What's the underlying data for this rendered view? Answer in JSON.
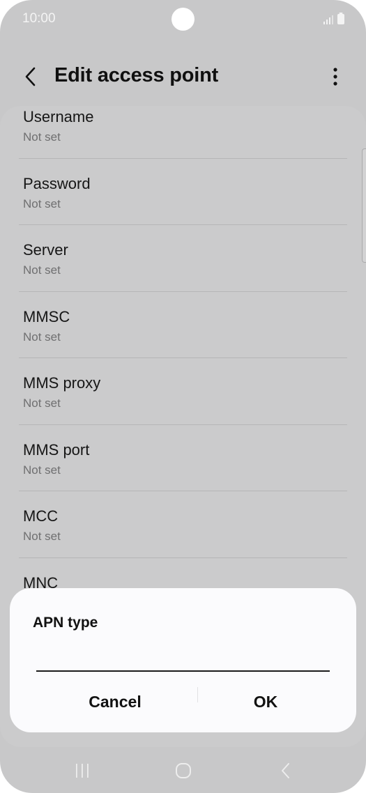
{
  "status_bar": {
    "time": "10:00",
    "icons": [
      "signal-icon",
      "battery-icon"
    ]
  },
  "app_bar": {
    "title": "Edit access point",
    "back_icon": "chevron-left-icon",
    "more_icon": "more-vertical-icon"
  },
  "settings": [
    {
      "label": "Username",
      "value": "Not set"
    },
    {
      "label": "Password",
      "value": "Not set"
    },
    {
      "label": "Server",
      "value": "Not set"
    },
    {
      "label": "MMSC",
      "value": "Not set"
    },
    {
      "label": "MMS proxy",
      "value": "Not set"
    },
    {
      "label": "MMS port",
      "value": "Not set"
    },
    {
      "label": "MCC",
      "value": "Not set"
    },
    {
      "label": "MNC",
      "value": ""
    }
  ],
  "dialog": {
    "title": "APN type",
    "input_value": "",
    "cancel_label": "Cancel",
    "ok_label": "OK"
  },
  "nav_bar": {
    "icons": [
      "recents-icon",
      "home-icon",
      "back-icon"
    ]
  },
  "colors": {
    "screen_dim": "#c8c8c9",
    "dialog_background": "#fbfbfd",
    "text_primary": "#111111",
    "text_secondary": "#6f6f70"
  }
}
